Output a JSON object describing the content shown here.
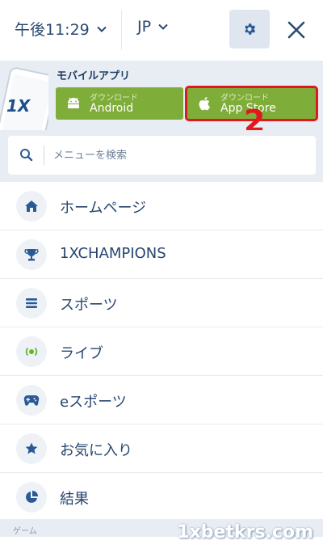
{
  "header": {
    "time": "午後11:29",
    "language": "JP"
  },
  "banner": {
    "title": "モバイルアプリ",
    "android": {
      "sub": "ダウンロード",
      "label": "Android"
    },
    "appstore": {
      "sub": "ダウンロード",
      "label": "App Store"
    },
    "callout": "2"
  },
  "search": {
    "placeholder": "メニューを検索"
  },
  "menu": {
    "items": [
      {
        "label": "ホームページ",
        "icon": "home-icon"
      },
      {
        "label": "1XCHAMPIONS",
        "icon": "trophy-icon"
      },
      {
        "label": "スポーツ",
        "icon": "list-icon"
      },
      {
        "label": "ライブ",
        "icon": "live-icon"
      },
      {
        "label": "eスポーツ",
        "icon": "gamepad-icon"
      },
      {
        "label": "お気に入り",
        "icon": "star-icon"
      },
      {
        "label": "結果",
        "icon": "pie-chart-icon"
      }
    ]
  },
  "section": {
    "label": "ゲーム"
  },
  "watermark": "1xbetkrs.com",
  "colors": {
    "accent_green": "#7fad3a",
    "text_navy": "#27466f",
    "highlight_red": "#e0191f",
    "live_green": "#6ab42d"
  }
}
